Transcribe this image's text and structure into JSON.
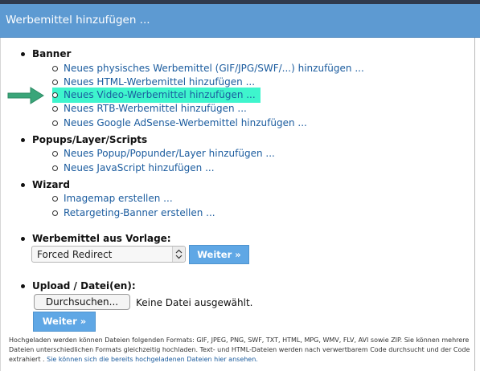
{
  "header": {
    "title": "Werbemittel hinzufügen ..."
  },
  "groups": {
    "banner": {
      "label": "Banner",
      "items": [
        "Neues physisches Werbemittel (GIF/JPG/SWF/...) hinzufügen ...",
        "Neues HTML-Werbemittel hinzufügen ...",
        "Neues Video-Werbemittel hinzufügen ...",
        "Neues RTB-Werbemittel hinzufügen ...",
        "Neues Google AdSense-Werbemittel hinzufügen ..."
      ]
    },
    "popups": {
      "label": "Popups/Layer/Scripts",
      "items": [
        "Neues Popup/Popunder/Layer hinzufügen ...",
        "Neues JavaScript hinzufügen ..."
      ]
    },
    "wizard": {
      "label": "Wizard",
      "items": [
        "Imagemap erstellen ...",
        "Retargeting-Banner erstellen ..."
      ]
    },
    "vorlage": {
      "label": "Werbemittel aus Vorlage:",
      "selected": "Forced Redirect",
      "button": "Weiter »"
    },
    "upload": {
      "label": "Upload / Datei(en):",
      "file_button": "Durchsuchen...",
      "file_status": "Keine Datei ausgewählt.",
      "button": "Weiter »",
      "help_line1": "Hochgeladen werden können Dateien folgenden Formats: GIF, JPEG, PNG, SWF, TXT, HTML, MPG, WMV, FLV, AVI sowie ZIP. Sie können mehrere",
      "help_line2": "Dateien unterschiedlichen Formats gleichzeitig hochladen. Text- und HTML-Dateien werden nach verwertbarem Code durchsucht und der Code",
      "help_line3_text": "extrahiert .",
      "help_line3_link": "Sie können sich die bereits hochgeladenen Dateien hier ansehen."
    }
  },
  "colors": {
    "header": "#5d9ad2",
    "highlight": "#3ef5cd",
    "arrow": "#3aa579",
    "link": "#1a5b9e",
    "button": "#5fa7e5"
  },
  "icons": {
    "pointer": "arrow-right-icon",
    "select": "select-updown-icon"
  }
}
